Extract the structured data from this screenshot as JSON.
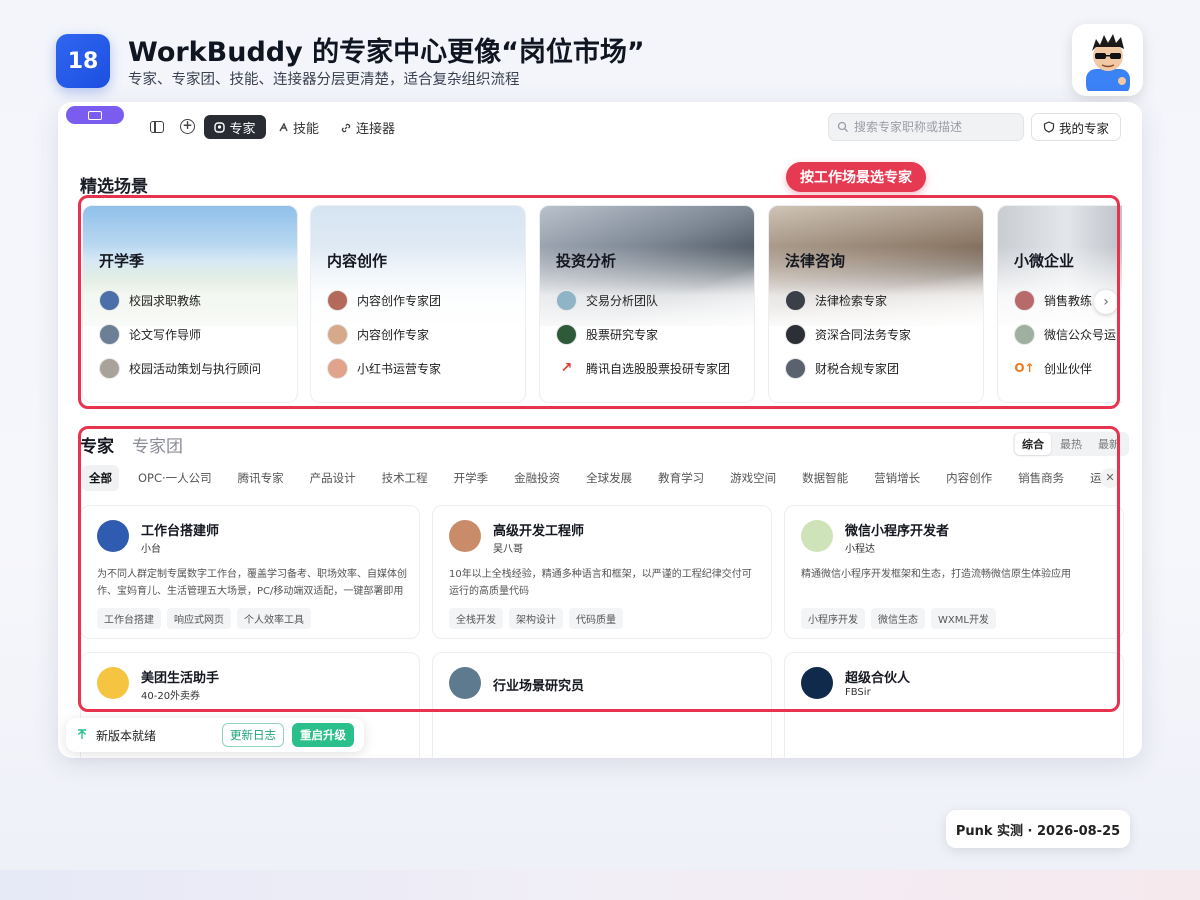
{
  "header": {
    "number": "18",
    "title": "WorkBuddy 的专家中心更像“岗位市场”",
    "subtitle": "专家、专家团、技能、连接器分层更清楚，适合复杂组织流程"
  },
  "nav": {
    "active": "专家",
    "skills": "技能",
    "connectors": "连接器",
    "search_placeholder": "搜索专家职称或描述",
    "my_experts": "我的专家"
  },
  "featured": {
    "title": "精选场景",
    "annotation": "按工作场景选专家",
    "cards": [
      {
        "title": "开学季",
        "items": [
          "校园求职教练",
          "论文写作导师",
          "校园活动策划与执行顾问"
        ]
      },
      {
        "title": "内容创作",
        "items": [
          "内容创作专家团",
          "内容创作专家",
          "小红书运营专家"
        ]
      },
      {
        "title": "投资分析",
        "items": [
          "交易分析团队",
          "股票研究专家",
          "腾讯自选股股票投研专家团"
        ]
      },
      {
        "title": "法律咨询",
        "items": [
          "法律检索专家",
          "资深合同法务专家",
          "财税合规专家团"
        ]
      },
      {
        "title": "小微企业",
        "items": [
          "销售教练",
          "微信公众号运",
          "创业伙伴"
        ]
      }
    ]
  },
  "experts": {
    "tab_experts": "专家",
    "tab_teams": "专家团",
    "sort": [
      "综合",
      "最热",
      "最新"
    ],
    "categories": [
      "全部",
      "OPC·一人公司",
      "腾讯专家",
      "产品设计",
      "技术工程",
      "开学季",
      "金融投资",
      "全球发展",
      "教育学习",
      "游戏空间",
      "数据智能",
      "营销增长",
      "内容创作",
      "销售商务",
      "运营"
    ],
    "cards": [
      {
        "name": "工作台搭建师",
        "sub": "小台",
        "desc": "为不同人群定制专属数字工作台，覆盖学习备考、职场效率、自媒体创作、宝妈育儿、生活管理五大场景，PC/移动端双适配，一键部署即用",
        "tags": [
          "工作台搭建",
          "响应式网页",
          "个人效率工具"
        ]
      },
      {
        "name": "高级开发工程师",
        "sub": "吴八哥",
        "desc": "10年以上全栈经验，精通多种语言和框架，以严谨的工程纪律交付可运行的高质量代码",
        "tags": [
          "全栈开发",
          "架构设计",
          "代码质量"
        ]
      },
      {
        "name": "微信小程序开发者",
        "sub": "小程达",
        "desc": "精通微信小程序开发框架和生态，打造流畅微信原生体验应用",
        "tags": [
          "小程序开发",
          "微信生态",
          "WXML开发"
        ]
      },
      {
        "name": "美团生活助手",
        "sub": "40-20外卖券",
        "desc": "",
        "tags": []
      },
      {
        "name": "行业场景研究员",
        "sub": "",
        "desc": "",
        "tags": []
      },
      {
        "name": "超级合伙人",
        "sub": "FBSir",
        "desc": "",
        "tags": []
      }
    ]
  },
  "update": {
    "text": "新版本就绪",
    "changelog": "更新日志",
    "restart": "重启升级"
  },
  "footer": "Punk 实测 · 2026-08-25",
  "colors": {
    "accent_blue": "#2f66f0",
    "highlight_red": "#e8334f",
    "update_green": "#2bbf8b"
  }
}
